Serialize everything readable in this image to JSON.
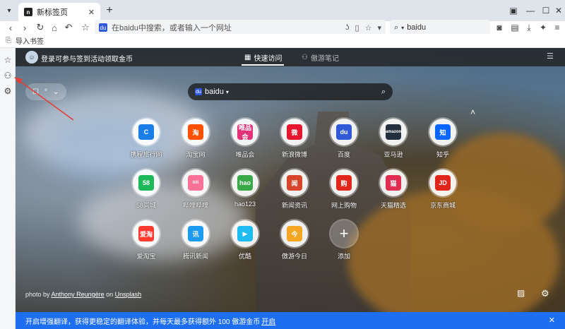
{
  "tab": {
    "title": "新标签页",
    "favicon_text": "n"
  },
  "address": {
    "placeholder": "在baidu中搜索，或者输入一个网址"
  },
  "search_engine_box": {
    "value": "baidu"
  },
  "bookmarks_bar": {
    "import_label": "导入书签"
  },
  "page": {
    "user_prompt": "登录可参与签到活动领取金币",
    "tabs": [
      {
        "label": "快速访问"
      },
      {
        "label": "傲游笔记"
      }
    ],
    "weather_text": "°",
    "search": {
      "engine": "baidu"
    },
    "tiles": [
      {
        "label": "携程旅行网",
        "logo": "C",
        "color": "#1b7ee8"
      },
      {
        "label": "淘宝网",
        "logo": "淘",
        "color": "#ff5000"
      },
      {
        "label": "唯品会",
        "logo": "唯品会",
        "color": "#e2327a"
      },
      {
        "label": "新浪微博",
        "logo": "微",
        "color": "#e6162d"
      },
      {
        "label": "百度",
        "logo": "du",
        "color": "#2f59d8"
      },
      {
        "label": "亚马逊",
        "logo": "amazon",
        "color": "#232f3e"
      },
      {
        "label": "知乎",
        "logo": "知",
        "color": "#0a66ff"
      },
      {
        "label": "58同城",
        "logo": "58",
        "color": "#1cb85a"
      },
      {
        "label": "哔哩哔哩",
        "logo": "bili",
        "color": "#fb7299"
      },
      {
        "label": "hao123",
        "logo": "hao",
        "color": "#39a846"
      },
      {
        "label": "新闻资讯",
        "logo": "闻",
        "color": "#d9452b"
      },
      {
        "label": "网上购物",
        "logo": "购",
        "color": "#e1251b"
      },
      {
        "label": "天猫精选",
        "logo": "猫",
        "color": "#e02d51"
      },
      {
        "label": "京东商城",
        "logo": "JD",
        "color": "#e1251b"
      },
      {
        "label": "爱淘宝",
        "logo": "爱淘",
        "color": "#ff3b30"
      },
      {
        "label": "腾讯新闻",
        "logo": "讯",
        "color": "#1d9bf0"
      },
      {
        "label": "优酷",
        "logo": "▶",
        "color": "#1ebcf0"
      },
      {
        "label": "傲游今日",
        "logo": "今",
        "color": "#f5a623"
      },
      {
        "label": "添加",
        "logo": "+",
        "color": ""
      }
    ],
    "photo_credit": {
      "prefix": "photo by",
      "author": "Anthony Reungère",
      "on": "on",
      "site": "Unsplash"
    }
  },
  "banner": {
    "text": "开启增强翻译，获得更稳定的翻译体验，并每天最多获得额外 100 傲游金币",
    "link": "开启"
  }
}
